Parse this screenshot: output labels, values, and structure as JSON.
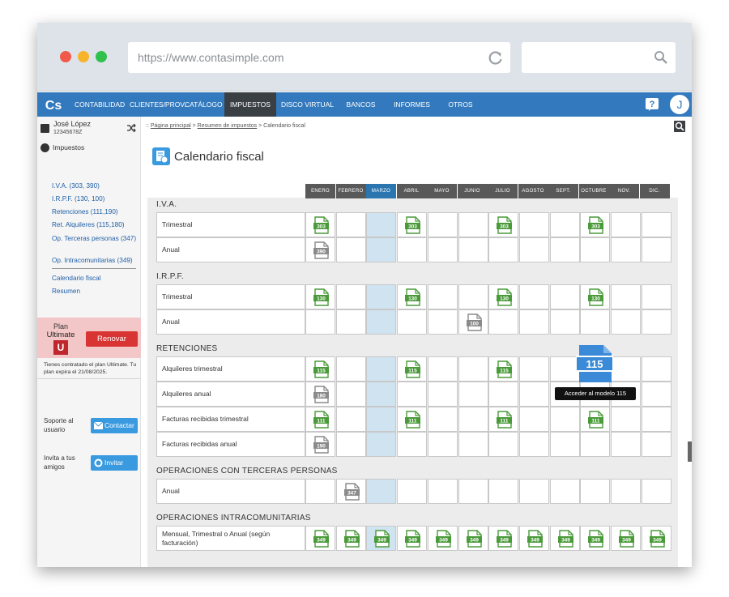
{
  "browser": {
    "url": "https://www.contasimple.com"
  },
  "nav": {
    "logo": "Cs",
    "items": [
      "CONTABILIDAD",
      "CLIENTES/PROV.",
      "CATÁLOGO",
      "IMPUESTOS",
      "DISCO VIRTUAL",
      "BANCOS",
      "INFORMES",
      "OTROS"
    ],
    "active": "IMPUESTOS",
    "help": "?",
    "avatar": "J"
  },
  "user": {
    "name": "José López",
    "nif": "12345678Z"
  },
  "sidebar": {
    "section": "Impuestos",
    "links": [
      "I.V.A. (303, 390)",
      "I.R.P.F. (130, 100)",
      "Retenciones (111,190)",
      "Ret. Alquileres (115,180)",
      "Op. Terceras personas (347)",
      "Op. Intracomunitarias (349)",
      "Calendario fiscal",
      "Resumen"
    ]
  },
  "plan": {
    "label": "Plan",
    "name": "Ultimate",
    "badge": "U",
    "renew": "Renovar",
    "note": "Tienes contratado el plan Ultimate. Tu plan expira el 21/08/2025."
  },
  "help": {
    "support_label": "Soporte al usuario",
    "contact_button": "Contactar",
    "invite_label": "Invita a tus amigos",
    "invite_button": "Invitar"
  },
  "breadcrumb": {
    "prefix": ":: ",
    "items": [
      "Página principal",
      "Resumen de impuestos",
      "Calendario fiscal"
    ]
  },
  "page": {
    "title": "Calendario fiscal"
  },
  "calendar": {
    "months": [
      "ENERO",
      "FEBRERO",
      "MARZO",
      "ABRIL",
      "MAYO",
      "JUNIO",
      "JULIO",
      "AGOSTO",
      "SEPT.",
      "OCTUBRE",
      "NOV.",
      "DIC."
    ],
    "current_month_index": 2,
    "colors": {
      "pending": "#4a9a3a",
      "future": "#8a8a8a",
      "highlight": "#3a8ad8"
    },
    "groups": [
      {
        "label": "I.V.A.",
        "rows": [
          {
            "label": "Trimestral",
            "cells": [
              {
                "m": 0,
                "code": "303",
                "c": "pending"
              },
              {
                "m": 3,
                "code": "303",
                "c": "pending"
              },
              {
                "m": 6,
                "code": "303",
                "c": "pending"
              },
              {
                "m": 9,
                "code": "303",
                "c": "pending"
              }
            ]
          },
          {
            "label": "Anual",
            "cells": [
              {
                "m": 0,
                "code": "390",
                "c": "future"
              }
            ]
          }
        ]
      },
      {
        "label": "I.R.P.F.",
        "rows": [
          {
            "label": "Trimestral",
            "cells": [
              {
                "m": 0,
                "code": "130",
                "c": "pending"
              },
              {
                "m": 3,
                "code": "130",
                "c": "pending"
              },
              {
                "m": 6,
                "code": "130",
                "c": "pending"
              },
              {
                "m": 9,
                "code": "130",
                "c": "pending"
              }
            ]
          },
          {
            "label": "Anual",
            "cells": [
              {
                "m": 5,
                "code": "100",
                "c": "future"
              }
            ]
          }
        ]
      },
      {
        "label": "RETENCIONES",
        "rows": [
          {
            "label": "Alquileres trimestral",
            "cells": [
              {
                "m": 0,
                "code": "115",
                "c": "pending"
              },
              {
                "m": 3,
                "code": "115",
                "c": "pending"
              },
              {
                "m": 6,
                "code": "115",
                "c": "pending"
              }
            ]
          },
          {
            "label": "Alquileres anual",
            "cells": [
              {
                "m": 0,
                "code": "180",
                "c": "future"
              }
            ]
          },
          {
            "label": "Facturas recibidas trimestral",
            "cells": [
              {
                "m": 0,
                "code": "111",
                "c": "pending"
              },
              {
                "m": 3,
                "code": "111",
                "c": "pending"
              },
              {
                "m": 6,
                "code": "111",
                "c": "pending"
              },
              {
                "m": 9,
                "code": "111",
                "c": "pending"
              }
            ]
          },
          {
            "label": "Facturas recibidas anual",
            "cells": [
              {
                "m": 0,
                "code": "190",
                "c": "future"
              }
            ]
          }
        ]
      },
      {
        "label": "OPERACIONES CON TERCERAS PERSONAS",
        "rows": [
          {
            "label": "Anual",
            "cells": [
              {
                "m": 1,
                "code": "347",
                "c": "future"
              }
            ]
          }
        ]
      },
      {
        "label": "OPERACIONES INTRACOMUNITARIAS",
        "rows": [
          {
            "label": "Mensual, Trimestral o Anual (según facturación)",
            "cells": [
              {
                "m": 0,
                "code": "349",
                "c": "pending"
              },
              {
                "m": 1,
                "code": "349",
                "c": "pending"
              },
              {
                "m": 2,
                "code": "349",
                "c": "pending"
              },
              {
                "m": 3,
                "code": "349",
                "c": "pending"
              },
              {
                "m": 4,
                "code": "349",
                "c": "pending"
              },
              {
                "m": 5,
                "code": "349",
                "c": "pending"
              },
              {
                "m": 6,
                "code": "349",
                "c": "pending"
              },
              {
                "m": 7,
                "code": "349",
                "c": "pending"
              },
              {
                "m": 8,
                "code": "349",
                "c": "pending"
              },
              {
                "m": 9,
                "code": "349",
                "c": "pending"
              },
              {
                "m": 10,
                "code": "349",
                "c": "pending"
              },
              {
                "m": 11,
                "code": "349",
                "c": "pending"
              }
            ]
          }
        ]
      }
    ]
  },
  "tooltip": {
    "code": "115",
    "text": "Acceder al modelo 115"
  }
}
